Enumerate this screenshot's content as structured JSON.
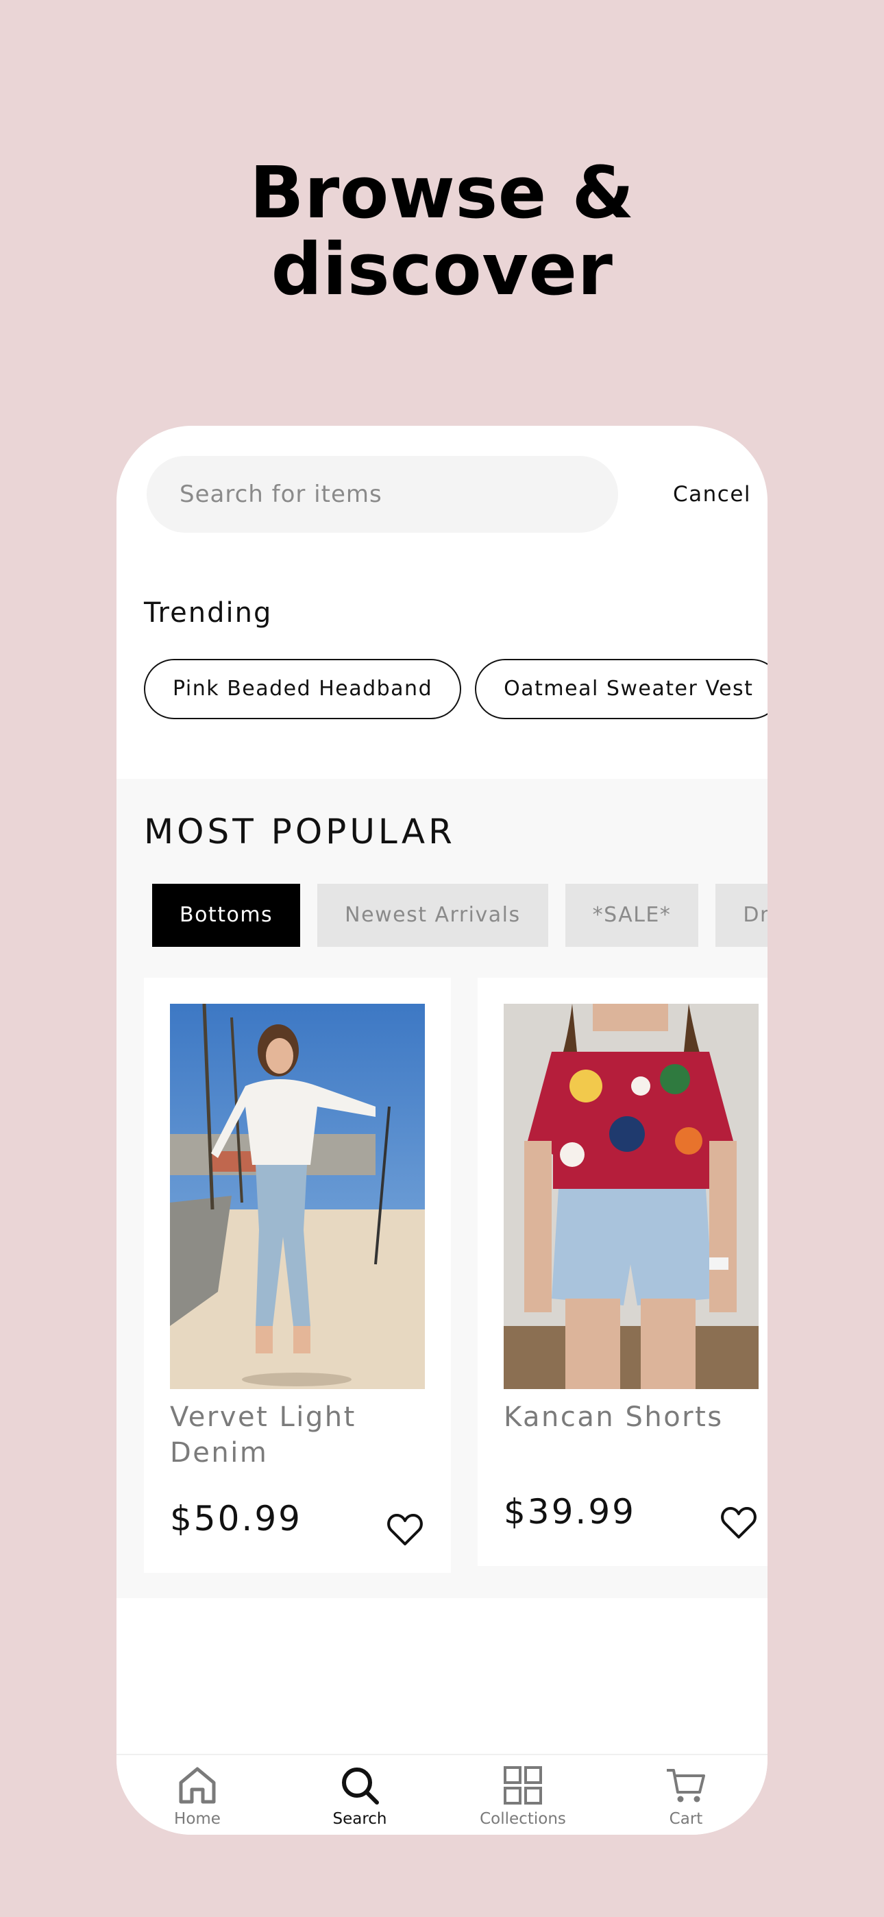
{
  "headline": {
    "line1": "Browse &",
    "line2": "discover"
  },
  "search": {
    "placeholder": "Search for items",
    "cancel_label": "Cancel"
  },
  "trending": {
    "title": "Trending",
    "items": [
      "Pink Beaded Headband",
      "Oatmeal Sweater Vest"
    ]
  },
  "popular": {
    "title": "MOST POPULAR",
    "tabs": [
      {
        "label": "Bottoms",
        "active": true
      },
      {
        "label": "Newest Arrivals",
        "active": false
      },
      {
        "label": "*SALE*",
        "active": false
      },
      {
        "label": "Dre",
        "active": false
      }
    ],
    "products": [
      {
        "name": "Vervet Light Denim",
        "price": "$50.99"
      },
      {
        "name": "Kancan Shorts",
        "price": "$39.99"
      }
    ]
  },
  "nav": {
    "items": [
      {
        "label": "Home",
        "icon": "home-icon",
        "active": false
      },
      {
        "label": "Search",
        "icon": "search-icon",
        "active": true
      },
      {
        "label": "Collections",
        "icon": "grid-icon",
        "active": false
      },
      {
        "label": "Cart",
        "icon": "cart-icon",
        "active": false
      }
    ]
  },
  "colors": {
    "background": "#ead5d6",
    "accent": "#000000"
  }
}
